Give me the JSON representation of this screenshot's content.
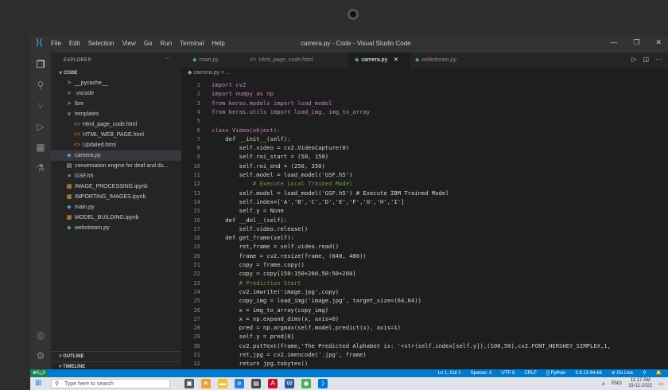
{
  "window": {
    "title": "camera.py - Code - Visual Studio Code",
    "menu": [
      "File",
      "Edit",
      "Selection",
      "View",
      "Go",
      "Run",
      "Terminal",
      "Help"
    ],
    "controls": [
      "—",
      "❐",
      "✕"
    ]
  },
  "sidebar": {
    "header": "EXPLORER",
    "more": "···",
    "root": "CODE",
    "items": [
      {
        "label": "__pycache__",
        "icon": ">",
        "level": 1,
        "color": "#cccccc"
      },
      {
        "label": ".vscode",
        "icon": ">",
        "level": 1,
        "color": "#cccccc"
      },
      {
        "label": "ibm",
        "icon": ">",
        "level": 1,
        "color": "#cccccc"
      },
      {
        "label": "templates",
        "icon": "∨",
        "level": 1,
        "color": "#cccccc"
      },
      {
        "label": "Html_page_code.html",
        "icon": "<>",
        "level": 2,
        "color": "#e37933"
      },
      {
        "label": "HTML_WEB_PAGE.html",
        "icon": "<>",
        "level": 2,
        "color": "#e37933"
      },
      {
        "label": "Updated.html",
        "icon": "<>",
        "level": 2,
        "color": "#e37933"
      },
      {
        "label": "camera.py",
        "icon": "◆",
        "level": 1,
        "color": "#519aba"
      },
      {
        "label": "conversation engine for deaf and du...",
        "icon": "▤",
        "level": 1,
        "color": "#cccccc"
      },
      {
        "label": "GSF.h5",
        "icon": "≡",
        "level": 1,
        "color": "#cccccc"
      },
      {
        "label": "IMAGE_PROCESSING.ipynb",
        "icon": "▦",
        "level": 1,
        "color": "#f0a030"
      },
      {
        "label": "IMPORTING_IMAGES.ipynb",
        "icon": "▦",
        "level": 1,
        "color": "#f0a030"
      },
      {
        "label": "main.py",
        "icon": "◆",
        "level": 1,
        "color": "#519aba"
      },
      {
        "label": "MODEL_BUILDING.ipynb",
        "icon": "▦",
        "level": 1,
        "color": "#f0a030"
      },
      {
        "label": "webstream.py",
        "icon": "◆",
        "level": 1,
        "color": "#519aba"
      }
    ],
    "outline": "OUTLINE",
    "timeline": "TIMELINE"
  },
  "tabs": [
    {
      "label": "main.py",
      "icon": "◆",
      "active": false
    },
    {
      "label": "Html_page_code.html",
      "icon": "<>",
      "active": false
    },
    {
      "label": "camera.py",
      "icon": "◆",
      "active": true,
      "close": "✕"
    },
    {
      "label": "webstream.py",
      "icon": "◆",
      "active": false
    }
  ],
  "breadcrumb": "◆ camera.py > ...",
  "code_lines": [
    {
      "n": "1",
      "text": "import cv2"
    },
    {
      "n": "2",
      "text": "import numpy as np"
    },
    {
      "n": "3",
      "text": "from keras.models import load_model"
    },
    {
      "n": "4",
      "text": "from keras.utils import load_img, img_to_array"
    },
    {
      "n": "5",
      "text": ""
    },
    {
      "n": "6",
      "text": "class Video(object):"
    },
    {
      "n": "7",
      "text": "    def __init__(self):"
    },
    {
      "n": "8",
      "text": "        self.video = cv2.VideoCapture(0)"
    },
    {
      "n": "9",
      "text": "        self.roi_start = (50, 150)"
    },
    {
      "n": "10",
      "text": "        self.roi_end = (250, 350)"
    },
    {
      "n": "11",
      "text": "        self.model = load_model('GSF.h5')"
    },
    {
      "n": "12",
      "text": "            # Execute Local Trained Model"
    },
    {
      "n": "13",
      "text": "        self.model = load_model('GSF.h5') # Execute IBM Trained Model"
    },
    {
      "n": "14",
      "text": "        self.index=['A','B','C','D','E','F','G','H','I']"
    },
    {
      "n": "15",
      "text": "        self.y = None"
    },
    {
      "n": "16",
      "text": "    def __del__(self):"
    },
    {
      "n": "17",
      "text": "        self.video.release()"
    },
    {
      "n": "18",
      "text": "    def get_frame(self):"
    },
    {
      "n": "19",
      "text": "        ret,frame = self.video.read()"
    },
    {
      "n": "20",
      "text": "        frame = cv2.resize(frame, (640, 480))"
    },
    {
      "n": "21",
      "text": "        copy = frame.copy()"
    },
    {
      "n": "22",
      "text": "        copy = copy[150:150+200,50:50+200]"
    },
    {
      "n": "23",
      "text": "        # Prediction Start"
    },
    {
      "n": "24",
      "text": "        cv2.imwrite('image.jpg',copy)"
    },
    {
      "n": "25",
      "text": "        copy_img = load_img('image.jpg', target_size=(64,64))"
    },
    {
      "n": "26",
      "text": "        x = img_to_array(copy_img)"
    },
    {
      "n": "27",
      "text": "        x = np.expand_dims(x, axis=0)"
    },
    {
      "n": "28",
      "text": "        pred = np.argmax(self.model.predict(x), axis=1)"
    },
    {
      "n": "29",
      "text": "        self.y = pred[0]"
    },
    {
      "n": "30",
      "text": "        cv2.putText(frame,'The Predicted Alphabet is: '+str(self.index[self.y]),(100,50),cv2.FONT_HERSHEY_SIMPLEX,1,"
    },
    {
      "n": "31",
      "text": "        ret,jpg = cv2.imencode('.jpg', frame)"
    },
    {
      "n": "32",
      "text": "        return jpg.tobytes()"
    }
  ],
  "status": {
    "remote": "⊗0△0",
    "items": [
      "Ln 1, Col 1",
      "Spaces: 2",
      "UTF-8",
      "CRLF",
      "{} Python",
      "3.9.13 64-bit",
      "⊘ Go Live",
      "⚲",
      "🔔"
    ]
  },
  "taskbar": {
    "search_placeholder": "Type here to search",
    "lang": "ENG",
    "time": "11:17 AM",
    "date": "19-11-2022"
  },
  "colors": {
    "accent": "#007acc",
    "editor_bg": "#1e1e1e",
    "sidebar_bg": "#252526"
  }
}
